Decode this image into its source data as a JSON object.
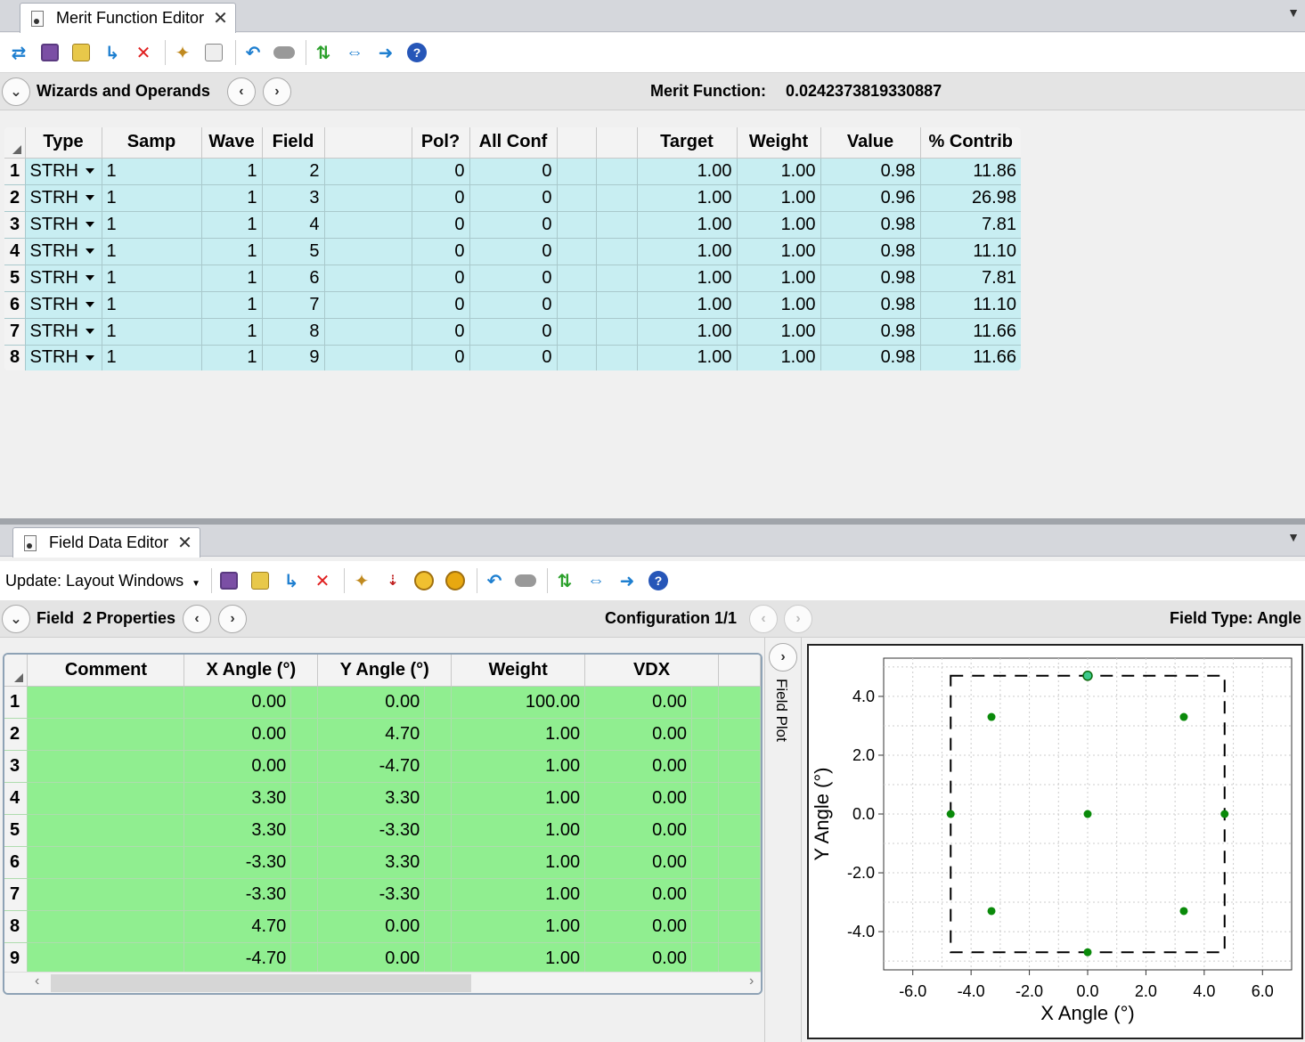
{
  "merit_editor": {
    "tab_title": "Merit Function Editor",
    "header": {
      "section_label": "Wizards and Operands",
      "merit_label": "Merit Function:",
      "merit_value": "0.0242373819330887"
    },
    "columns": [
      "Type",
      "Samp",
      "Wave",
      "Field",
      "",
      "Pol?",
      "All Conf",
      "",
      "",
      "Target",
      "Weight",
      "Value",
      "% Contrib"
    ],
    "rows": [
      {
        "n": "1",
        "type": "STRH",
        "samp": "1",
        "wave": "1",
        "field": "2",
        "pol": "0",
        "allconf": "0",
        "target": "1.00",
        "weight": "1.00",
        "value": "0.98",
        "contrib": "11.86"
      },
      {
        "n": "2",
        "type": "STRH",
        "samp": "1",
        "wave": "1",
        "field": "3",
        "pol": "0",
        "allconf": "0",
        "target": "1.00",
        "weight": "1.00",
        "value": "0.96",
        "contrib": "26.98"
      },
      {
        "n": "3",
        "type": "STRH",
        "samp": "1",
        "wave": "1",
        "field": "4",
        "pol": "0",
        "allconf": "0",
        "target": "1.00",
        "weight": "1.00",
        "value": "0.98",
        "contrib": "7.81"
      },
      {
        "n": "4",
        "type": "STRH",
        "samp": "1",
        "wave": "1",
        "field": "5",
        "pol": "0",
        "allconf": "0",
        "target": "1.00",
        "weight": "1.00",
        "value": "0.98",
        "contrib": "11.10"
      },
      {
        "n": "5",
        "type": "STRH",
        "samp": "1",
        "wave": "1",
        "field": "6",
        "pol": "0",
        "allconf": "0",
        "target": "1.00",
        "weight": "1.00",
        "value": "0.98",
        "contrib": "7.81"
      },
      {
        "n": "6",
        "type": "STRH",
        "samp": "1",
        "wave": "1",
        "field": "7",
        "pol": "0",
        "allconf": "0",
        "target": "1.00",
        "weight": "1.00",
        "value": "0.98",
        "contrib": "11.10"
      },
      {
        "n": "7",
        "type": "STRH",
        "samp": "1",
        "wave": "1",
        "field": "8",
        "pol": "0",
        "allconf": "0",
        "target": "1.00",
        "weight": "1.00",
        "value": "0.98",
        "contrib": "11.66"
      },
      {
        "n": "8",
        "type": "STRH",
        "samp": "1",
        "wave": "1",
        "field": "9",
        "pol": "0",
        "allconf": "0",
        "target": "1.00",
        "weight": "1.00",
        "value": "0.98",
        "contrib": "11.66"
      }
    ]
  },
  "field_editor": {
    "tab_title": "Field Data Editor",
    "update_label": "Update: Layout Windows",
    "header": {
      "field_label": "Field  2 Properties",
      "config_label": "Configuration 1/1",
      "field_type": "Field Type: Angle"
    },
    "columns": [
      "Comment",
      "X Angle (°)",
      "Y Angle (°)",
      "Weight",
      "VDX"
    ],
    "rows": [
      {
        "n": "1",
        "comment": "",
        "x": "0.00",
        "y": "0.00",
        "weight": "100.00",
        "vdx": "0.00"
      },
      {
        "n": "2",
        "comment": "",
        "x": "0.00",
        "y": "4.70",
        "weight": "1.00",
        "vdx": "0.00"
      },
      {
        "n": "3",
        "comment": "",
        "x": "0.00",
        "y": "-4.70",
        "weight": "1.00",
        "vdx": "0.00"
      },
      {
        "n": "4",
        "comment": "",
        "x": "3.30",
        "y": "3.30",
        "weight": "1.00",
        "vdx": "0.00"
      },
      {
        "n": "5",
        "comment": "",
        "x": "3.30",
        "y": "-3.30",
        "weight": "1.00",
        "vdx": "0.00"
      },
      {
        "n": "6",
        "comment": "",
        "x": "-3.30",
        "y": "3.30",
        "weight": "1.00",
        "vdx": "0.00"
      },
      {
        "n": "7",
        "comment": "",
        "x": "-3.30",
        "y": "-3.30",
        "weight": "1.00",
        "vdx": "0.00"
      },
      {
        "n": "8",
        "comment": "",
        "x": "4.70",
        "y": "0.00",
        "weight": "1.00",
        "vdx": "0.00"
      },
      {
        "n": "9",
        "comment": "",
        "x": "-4.70",
        "y": "0.00",
        "weight": "1.00",
        "vdx": "0.00"
      }
    ],
    "field_plot_label": "Field Plot"
  },
  "colors": {
    "merit_row_bg": "#c8eef2",
    "field_row_bg": "#90ee90",
    "plot_point": "#0a8a0a",
    "selected_point": "#3cc98c"
  },
  "chart_data": {
    "type": "scatter",
    "xlabel": "X Angle (°)",
    "ylabel": "Y Angle (°)",
    "xlim": [
      -7.0,
      7.0
    ],
    "ylim": [
      -5.3,
      5.3
    ],
    "xticks": [
      "-6.0",
      "-4.0",
      "-2.0",
      "0.0",
      "2.0",
      "4.0",
      "6.0"
    ],
    "yticks": [
      "4.0",
      "2.0",
      "0.0",
      "-2.0",
      "-4.0"
    ],
    "grid": true,
    "boundary": {
      "x": [
        -4.7,
        4.7
      ],
      "y": [
        -4.7,
        4.7
      ],
      "style": "dashed"
    },
    "points": [
      {
        "x": 0.0,
        "y": 0.0
      },
      {
        "x": 0.0,
        "y": 4.7,
        "selected": true
      },
      {
        "x": 0.0,
        "y": -4.7
      },
      {
        "x": 3.3,
        "y": 3.3
      },
      {
        "x": 3.3,
        "y": -3.3
      },
      {
        "x": -3.3,
        "y": 3.3
      },
      {
        "x": -3.3,
        "y": -3.3
      },
      {
        "x": 4.7,
        "y": 0.0
      },
      {
        "x": -4.7,
        "y": 0.0
      }
    ]
  }
}
